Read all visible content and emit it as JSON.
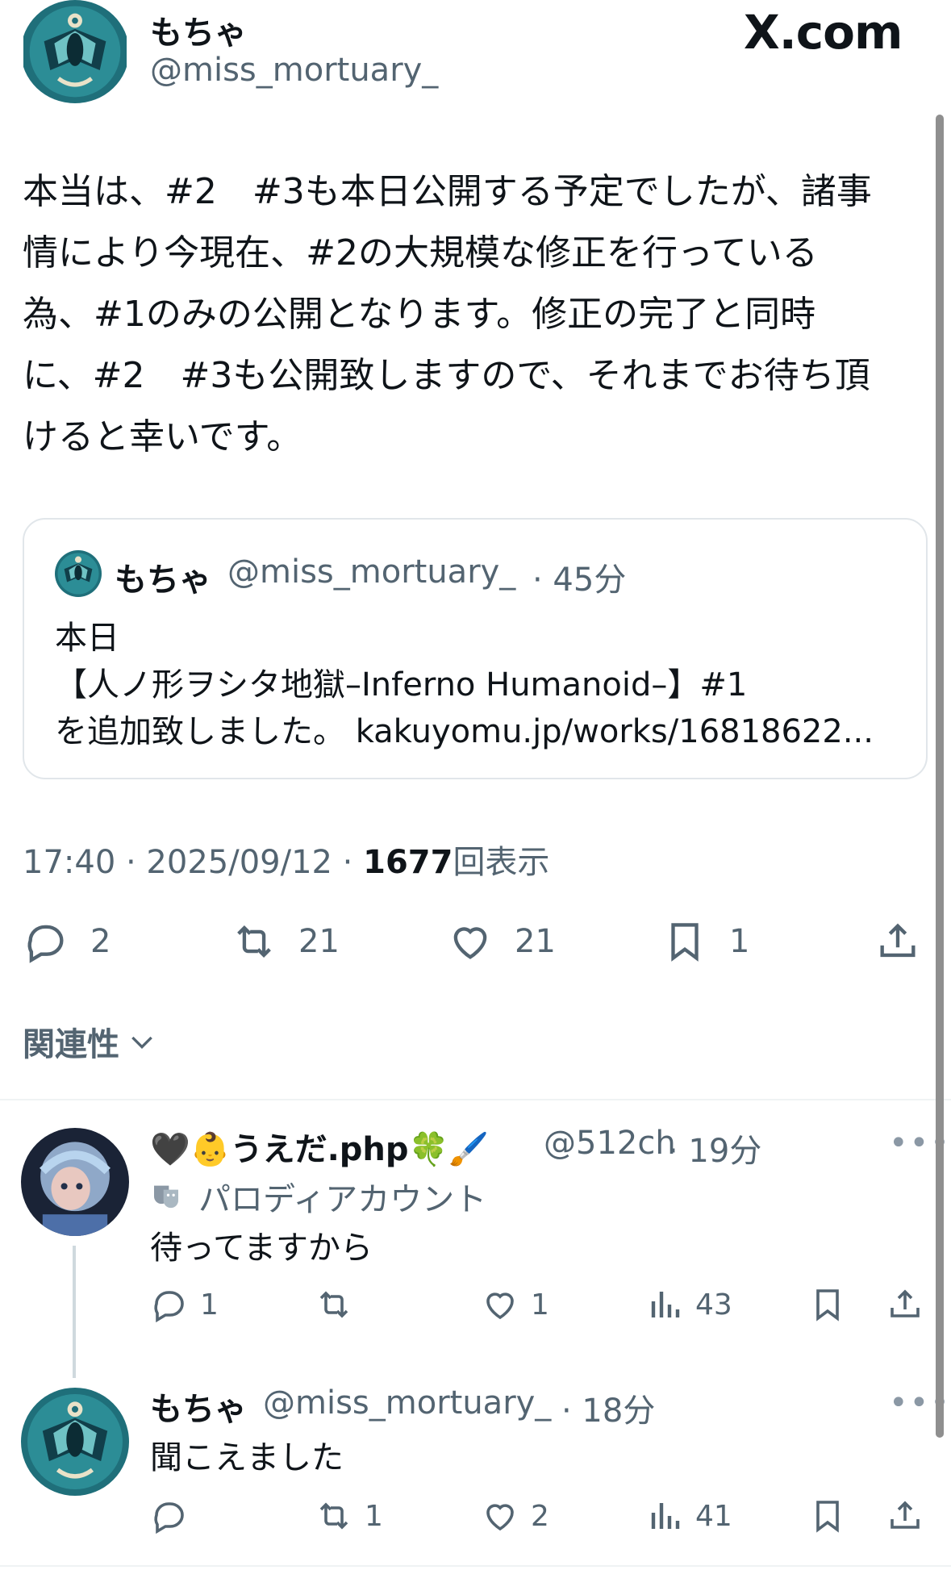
{
  "header": {
    "name": "もちゃ",
    "handle": "@miss_mortuary_",
    "logo_text": "X.com"
  },
  "post": {
    "text": "本当は、#2　#3も本日公開する予定でしたが、諸事\n情により今現在、#2の大規模な修正を行っている\n為、#1のみの公開となります。修正の完了と同時\nに、#2　#3も公開致しますので、それまでお待ち頂\nけると幸いです。",
    "quote": {
      "name": "もちゃ",
      "handle": "@miss_mortuary_",
      "time": "· 45分",
      "body": "本日\n【人ノ形ヲシタ地獄–Inferno Humanoid–】#1\nを追加致しました。 kakuyomu.jp/works/16818622..."
    },
    "meta": {
      "time": "17:40 · 2025/09/12 · ",
      "views_count": "1677",
      "views_label": "回表示"
    },
    "actions": {
      "replies": "2",
      "reposts": "21",
      "likes": "21",
      "bookmarks": "1"
    }
  },
  "relevance_label": "関連性",
  "replies": [
    {
      "name": "🖤👶うえだ.php🍀🖌️",
      "handle": "@512ch",
      "time": "· 19分",
      "parody_label": "パロディアカウント",
      "text": "待ってますから",
      "replies": "1",
      "reposts": "",
      "likes": "1",
      "views": "43",
      "more": "•••"
    },
    {
      "name": "もちゃ",
      "handle": "@miss_mortuary_",
      "time": "· 18分",
      "text": "聞こえました",
      "replies": "",
      "reposts": "1",
      "likes": "2",
      "views": "41",
      "more": "•••"
    }
  ],
  "icons": {
    "reply": "reply-icon",
    "repost": "repost-icon",
    "like": "heart-icon",
    "bookmark": "bookmark-icon",
    "share": "share-icon",
    "views": "views-icon",
    "chevron": "chevron-down-icon",
    "parody": "parody-mask-icon"
  },
  "colors": {
    "text_primary": "#0f1419",
    "text_secondary": "#536471",
    "border": "#e1e6ea",
    "avatar_bg": "#1f6f7a"
  }
}
